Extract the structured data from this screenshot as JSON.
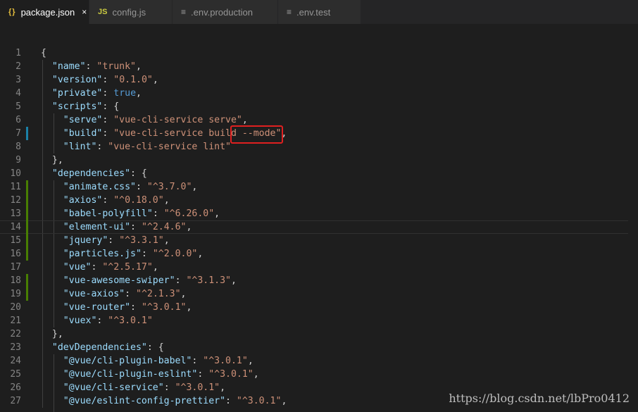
{
  "tabs": [
    {
      "icon": "json-braces-icon",
      "icon_text": "{}",
      "label": "package.json",
      "active": true,
      "close": "×"
    },
    {
      "icon": "js-file-icon",
      "icon_text": "JS",
      "label": "config.js",
      "active": false
    },
    {
      "icon": "text-lines-icon",
      "icon_text": "≡",
      "label": ".env.production",
      "active": false
    },
    {
      "icon": "text-lines-icon",
      "icon_text": "≡",
      "label": ".env.test",
      "active": false
    }
  ],
  "lines": [
    {
      "n": "1",
      "t": [
        [
          "p",
          "{"
        ]
      ]
    },
    {
      "n": "2",
      "t": [
        [
          "p",
          "  "
        ],
        [
          "k",
          "\"name\""
        ],
        [
          "p",
          ": "
        ],
        [
          "s",
          "\"trunk\""
        ],
        [
          "p",
          ","
        ]
      ]
    },
    {
      "n": "3",
      "t": [
        [
          "p",
          "  "
        ],
        [
          "k",
          "\"version\""
        ],
        [
          "p",
          ": "
        ],
        [
          "s",
          "\"0.1.0\""
        ],
        [
          "p",
          ","
        ]
      ]
    },
    {
      "n": "4",
      "t": [
        [
          "p",
          "  "
        ],
        [
          "k",
          "\"private\""
        ],
        [
          "p",
          ": "
        ],
        [
          "b",
          "true"
        ],
        [
          "p",
          ","
        ]
      ]
    },
    {
      "n": "5",
      "t": [
        [
          "p",
          "  "
        ],
        [
          "k",
          "\"scripts\""
        ],
        [
          "p",
          ": {"
        ]
      ]
    },
    {
      "n": "6",
      "t": [
        [
          "p",
          "    "
        ],
        [
          "k",
          "\"serve\""
        ],
        [
          "p",
          ": "
        ],
        [
          "s",
          "\"vue-cli-service serve\""
        ],
        [
          "p",
          ","
        ]
      ]
    },
    {
      "n": "7",
      "mark": "mod",
      "t": [
        [
          "p",
          "    "
        ],
        [
          "k",
          "\"build\""
        ],
        [
          "p",
          ": "
        ],
        [
          "s",
          "\"vue-cli-service build --mode\""
        ],
        [
          "p",
          ","
        ]
      ]
    },
    {
      "n": "8",
      "t": [
        [
          "p",
          "    "
        ],
        [
          "k",
          "\"lint\""
        ],
        [
          "p",
          ": "
        ],
        [
          "s",
          "\"vue-cli-service lint\""
        ]
      ]
    },
    {
      "n": "9",
      "t": [
        [
          "p",
          "  },"
        ]
      ]
    },
    {
      "n": "10",
      "t": [
        [
          "p",
          "  "
        ],
        [
          "k",
          "\"dependencies\""
        ],
        [
          "p",
          ": {"
        ]
      ]
    },
    {
      "n": "11",
      "mark": "add",
      "t": [
        [
          "p",
          "    "
        ],
        [
          "k",
          "\"animate.css\""
        ],
        [
          "p",
          ": "
        ],
        [
          "s",
          "\"^3.7.0\""
        ],
        [
          "p",
          ","
        ]
      ]
    },
    {
      "n": "12",
      "mark": "add",
      "t": [
        [
          "p",
          "    "
        ],
        [
          "k",
          "\"axios\""
        ],
        [
          "p",
          ": "
        ],
        [
          "s",
          "\"^0.18.0\""
        ],
        [
          "p",
          ","
        ]
      ]
    },
    {
      "n": "13",
      "mark": "add",
      "t": [
        [
          "p",
          "    "
        ],
        [
          "k",
          "\"babel-polyfill\""
        ],
        [
          "p",
          ": "
        ],
        [
          "s",
          "\"^6.26.0\""
        ],
        [
          "p",
          ","
        ]
      ]
    },
    {
      "n": "14",
      "mark": "add",
      "current": true,
      "t": [
        [
          "p",
          "    "
        ],
        [
          "k",
          "\"element-ui\""
        ],
        [
          "p",
          ": "
        ],
        [
          "s",
          "\"^2.4.6\""
        ],
        [
          "p",
          ","
        ]
      ]
    },
    {
      "n": "15",
      "mark": "add",
      "t": [
        [
          "p",
          "    "
        ],
        [
          "k",
          "\"jquery\""
        ],
        [
          "p",
          ": "
        ],
        [
          "s",
          "\"^3.3.1\""
        ],
        [
          "p",
          ","
        ]
      ]
    },
    {
      "n": "16",
      "mark": "add",
      "t": [
        [
          "p",
          "    "
        ],
        [
          "k",
          "\"particles.js\""
        ],
        [
          "p",
          ": "
        ],
        [
          "s",
          "\"^2.0.0\""
        ],
        [
          "p",
          ","
        ]
      ]
    },
    {
      "n": "17",
      "t": [
        [
          "p",
          "    "
        ],
        [
          "k",
          "\"vue\""
        ],
        [
          "p",
          ": "
        ],
        [
          "s",
          "\"^2.5.17\""
        ],
        [
          "p",
          ","
        ]
      ]
    },
    {
      "n": "18",
      "mark": "add",
      "t": [
        [
          "p",
          "    "
        ],
        [
          "k",
          "\"vue-awesome-swiper\""
        ],
        [
          "p",
          ": "
        ],
        [
          "s",
          "\"^3.1.3\""
        ],
        [
          "p",
          ","
        ]
      ]
    },
    {
      "n": "19",
      "mark": "add",
      "t": [
        [
          "p",
          "    "
        ],
        [
          "k",
          "\"vue-axios\""
        ],
        [
          "p",
          ": "
        ],
        [
          "s",
          "\"^2.1.3\""
        ],
        [
          "p",
          ","
        ]
      ]
    },
    {
      "n": "20",
      "t": [
        [
          "p",
          "    "
        ],
        [
          "k",
          "\"vue-router\""
        ],
        [
          "p",
          ": "
        ],
        [
          "s",
          "\"^3.0.1\""
        ],
        [
          "p",
          ","
        ]
      ]
    },
    {
      "n": "21",
      "t": [
        [
          "p",
          "    "
        ],
        [
          "k",
          "\"vuex\""
        ],
        [
          "p",
          ": "
        ],
        [
          "s",
          "\"^3.0.1\""
        ]
      ]
    },
    {
      "n": "22",
      "t": [
        [
          "p",
          "  },"
        ]
      ]
    },
    {
      "n": "23",
      "t": [
        [
          "p",
          "  "
        ],
        [
          "k",
          "\"devDependencies\""
        ],
        [
          "p",
          ": {"
        ]
      ]
    },
    {
      "n": "24",
      "t": [
        [
          "p",
          "    "
        ],
        [
          "k",
          "\"@vue/cli-plugin-babel\""
        ],
        [
          "p",
          ": "
        ],
        [
          "s",
          "\"^3.0.1\""
        ],
        [
          "p",
          ","
        ]
      ]
    },
    {
      "n": "25",
      "t": [
        [
          "p",
          "    "
        ],
        [
          "k",
          "\"@vue/cli-plugin-eslint\""
        ],
        [
          "p",
          ": "
        ],
        [
          "s",
          "\"^3.0.1\""
        ],
        [
          "p",
          ","
        ]
      ]
    },
    {
      "n": "26",
      "t": [
        [
          "p",
          "    "
        ],
        [
          "k",
          "\"@vue/cli-service\""
        ],
        [
          "p",
          ": "
        ],
        [
          "s",
          "\"^3.0.1\""
        ],
        [
          "p",
          ","
        ]
      ]
    },
    {
      "n": "27",
      "t": [
        [
          "p",
          "    "
        ],
        [
          "k",
          "\"@vue/eslint-config-prettier\""
        ],
        [
          "p",
          ": "
        ],
        [
          "s",
          "\"^3.0.1\""
        ],
        [
          "p",
          ","
        ]
      ]
    }
  ],
  "watermark": "https://blog.csdn.net/lbPro0412",
  "colors": {
    "key": "#9cdcfe",
    "string": "#ce9178",
    "boolean": "#569cd6",
    "highlight_box": "#e02020"
  }
}
